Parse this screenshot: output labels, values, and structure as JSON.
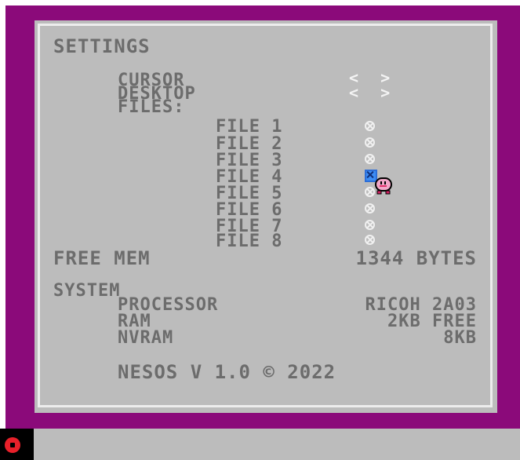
{
  "window": {
    "title": "SETTINGS",
    "cursor_label": "CURSOR",
    "desktop_label": "DESKTOP",
    "files_label": "FILES:",
    "arrow_control": "< >"
  },
  "files": [
    {
      "label": "FILE 1",
      "selected": false
    },
    {
      "label": "FILE 2",
      "selected": false
    },
    {
      "label": "FILE 3",
      "selected": false
    },
    {
      "label": "FILE 4",
      "selected": true
    },
    {
      "label": "FILE 5",
      "selected": false
    },
    {
      "label": "FILE 6",
      "selected": false
    },
    {
      "label": "FILE 7",
      "selected": false
    },
    {
      "label": "FILE 8",
      "selected": false
    }
  ],
  "free_mem": {
    "label": "FREE MEM",
    "value": "1344 BYTES"
  },
  "system": {
    "heading": "SYSTEM",
    "processor_label": "PROCESSOR",
    "processor_value": "RICOH 2A03",
    "ram_label": "RAM",
    "ram_value": "2KB FREE",
    "nvram_label": "NVRAM",
    "nvram_value": "8KB"
  },
  "footer": "NESOS V 1.0 © 2022",
  "icons": {
    "cursor_icon": "pink-ghost-pointer",
    "taskbar_icon": "red-ring-start-button"
  },
  "colors": {
    "frame": "#8b0a7a",
    "panel": "#bcbcbc",
    "text": "#6c6c6c",
    "highlight": "#3c8df4"
  }
}
